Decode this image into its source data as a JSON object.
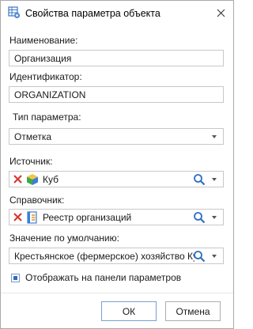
{
  "window": {
    "title": "Свойства параметра объекта",
    "app_icon": "grid-settings-icon",
    "close_icon": "close-icon"
  },
  "form": {
    "name_label": "Наименование:",
    "name_value": "Организация",
    "id_label": "Идентификатор:",
    "id_value": "ORGANIZATION",
    "type_label": "Тип параметра:",
    "type_value": "Отметка",
    "source_label": "Источник:",
    "source_value": "Куб",
    "dictionary_label": "Справочник:",
    "dictionary_value": "Реестр организаций",
    "default_label": "Значение по умолчанию:",
    "default_value": "Крестьянское (фермерское) хозяйство Кузь",
    "show_on_panel_label": "Отображать на панели параметров",
    "show_on_panel_checked": true
  },
  "buttons": {
    "ok": "ОК",
    "cancel": "Отмена"
  },
  "colors": {
    "accent": "#2e6db8",
    "clear_red": "#d9342b",
    "search_blue": "#2f6fc2"
  }
}
